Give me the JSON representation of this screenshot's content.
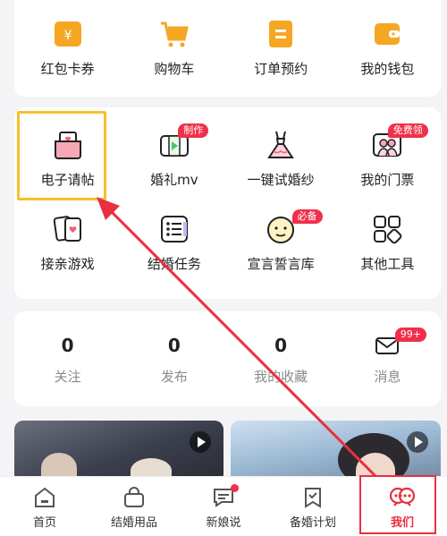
{
  "top_services": [
    {
      "label": "红包卡券",
      "icon": "coupon-icon"
    },
    {
      "label": "购物车",
      "icon": "cart-icon"
    },
    {
      "label": "订单预约",
      "icon": "order-icon"
    },
    {
      "label": "我的钱包",
      "icon": "wallet-icon"
    }
  ],
  "tools_row1": [
    {
      "label": "电子请帖",
      "icon": "invitation-icon",
      "badge": ""
    },
    {
      "label": "婚礼mv",
      "icon": "video-icon",
      "badge": "制作"
    },
    {
      "label": "一键试婚纱",
      "icon": "wedding-dress-icon",
      "badge": ""
    },
    {
      "label": "我的门票",
      "icon": "ticket-icon",
      "badge": "免费领"
    }
  ],
  "tools_row2": [
    {
      "label": "接亲游戏",
      "icon": "cards-icon",
      "badge": ""
    },
    {
      "label": "结婚任务",
      "icon": "checklist-icon",
      "badge": ""
    },
    {
      "label": "宣言誓言库",
      "icon": "vow-icon",
      "badge": "必备"
    },
    {
      "label": "其他工具",
      "icon": "apps-icon",
      "badge": ""
    }
  ],
  "stats": [
    {
      "value": "0",
      "label": "关注"
    },
    {
      "value": "0",
      "label": "发布"
    },
    {
      "value": "0",
      "label": "我的收藏"
    }
  ],
  "messages": {
    "label": "消息",
    "badge": "99+"
  },
  "nav": [
    {
      "label": "首页",
      "icon": "home-icon"
    },
    {
      "label": "结婚用品",
      "icon": "shopping-bag-icon"
    },
    {
      "label": "新娘说",
      "icon": "chat-icon"
    },
    {
      "label": "备婚计划",
      "icon": "bookmark-check-icon"
    },
    {
      "label": "我们",
      "icon": "couple-icon"
    }
  ],
  "colors": {
    "accent": "#e8303f",
    "orange": "#f5a623",
    "badge": "#f0304a",
    "highlight": "#f6c02e"
  }
}
